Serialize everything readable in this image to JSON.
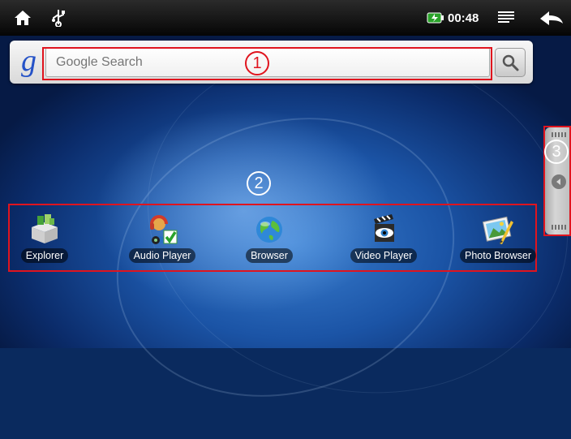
{
  "statusbar": {
    "left_icons": [
      "home-icon",
      "usb-icon"
    ],
    "battery_icon": "battery-icon",
    "time": "00:48",
    "menu_icon": "menu-icon",
    "back_icon": "back-icon"
  },
  "search": {
    "logo": "g",
    "placeholder": "Google Search",
    "button_icon": "magnifier-icon"
  },
  "apps": [
    {
      "label": "Explorer",
      "icon": "explorer-icon"
    },
    {
      "label": "Audio Player",
      "icon": "audio-player-icon"
    },
    {
      "label": "Browser",
      "icon": "browser-icon"
    },
    {
      "label": "Video Player",
      "icon": "video-player-icon"
    },
    {
      "label": "Photo Browser",
      "icon": "photo-browser-icon"
    }
  ],
  "annotations": {
    "marker_1": "1",
    "marker_2": "2",
    "marker_3": "3"
  },
  "colors": {
    "annotation_red": "#e0141e",
    "statusbar": "#111111",
    "wallpaper": "#1b54a6"
  }
}
